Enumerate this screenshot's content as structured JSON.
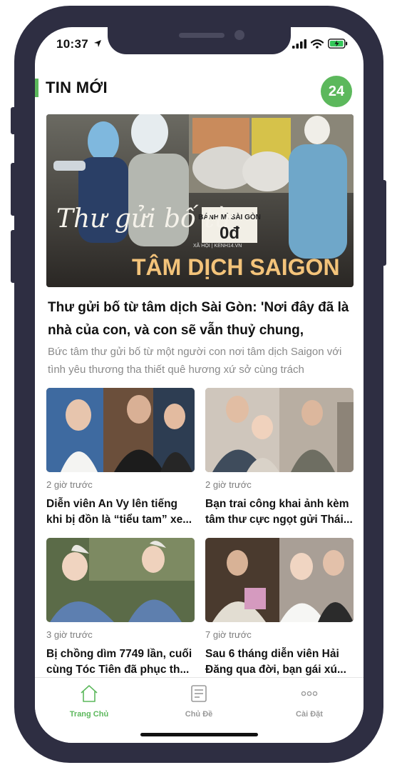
{
  "status_bar": {
    "time": "10:37"
  },
  "header": {
    "title": "TIN MỚI",
    "logo_text": "24"
  },
  "hero": {
    "image_overlay_script": "Thư gửi bố từ",
    "image_overlay_title": "TÂM DỊCH SAIGON",
    "image_sign_text": "BÁNH MÌ SÀI GÒN",
    "image_sign_price": "0đ",
    "image_small_text": "XÃ HỘI | KENH14.VN",
    "headline": "Thư gửi bố từ tâm dịch Sài Gòn: 'Nơi đây đã là nhà của con, và con sẽ vẫn thuỷ chung,",
    "summary": "Bức tâm thư gửi bố từ một người con nơi tâm dịch Saigon với tình yêu thương tha thiết quê hương xứ sở cùng trách"
  },
  "articles": [
    {
      "time_ago": "2 giờ trước",
      "title": "Diễn viên An Vy lên tiếng khi bị đồn là “tiểu tam” xe..."
    },
    {
      "time_ago": "2 giờ trước",
      "title": "Bạn trai công khai ảnh kèm tâm thư cực ngọt gửi Thái..."
    },
    {
      "time_ago": "3 giờ trước",
      "title": "Bị chồng dìm 7749 lần, cuối cùng Tóc Tiên đã phục th..."
    },
    {
      "time_ago": "7 giờ trước",
      "title": "Sau 6 tháng diễn viên Hải Đăng qua đời, bạn gái xú..."
    }
  ],
  "tabbar": {
    "items": [
      {
        "label": "Trang Chủ",
        "icon": "home-icon",
        "active": true
      },
      {
        "label": "Chủ Đề",
        "icon": "document-icon",
        "active": false
      },
      {
        "label": "Cài Đặt",
        "icon": "more-icon",
        "active": false
      }
    ]
  },
  "colors": {
    "accent": "#5cb85c",
    "frame": "#2e2e42",
    "inactive": "#9a9a9a"
  }
}
